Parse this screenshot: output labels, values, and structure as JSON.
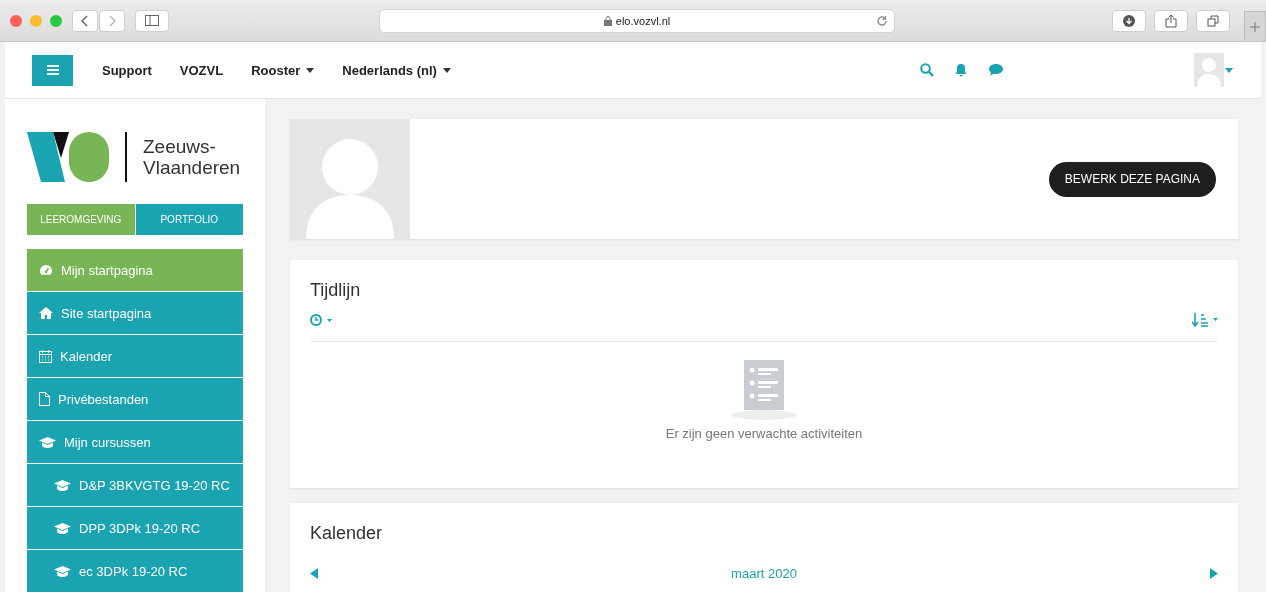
{
  "browser": {
    "url": "elo.vozvl.nl"
  },
  "navbar": {
    "links": [
      {
        "label": "Support",
        "dropdown": false
      },
      {
        "label": "VOZVL",
        "dropdown": false
      },
      {
        "label": "Rooster",
        "dropdown": true
      },
      {
        "label": "Nederlands (nl)",
        "dropdown": true
      }
    ]
  },
  "logo": {
    "lines": [
      "Zeeuws-",
      "Vlaanderen"
    ]
  },
  "tabs": [
    {
      "label": "LEEROMGEVING",
      "selected": true
    },
    {
      "label": "PORTFOLIO",
      "selected": false
    }
  ],
  "sidebar": {
    "items": [
      {
        "label": "Mijn startpagina",
        "kind": "dashboard",
        "selected": true
      },
      {
        "label": "Site startpagina",
        "kind": "home",
        "selected": false
      },
      {
        "label": "Kalender",
        "kind": "calendar",
        "selected": false
      },
      {
        "label": "Privébestanden",
        "kind": "file",
        "selected": false
      },
      {
        "label": "Mijn cursussen",
        "kind": "course",
        "selected": false,
        "children": [
          {
            "label": "D&P 3BKVGTG 19-20 RC",
            "kind": "course",
            "selected": false
          },
          {
            "label": "DPP 3DPk 19-20 RC",
            "kind": "course",
            "selected": false
          },
          {
            "label": "ec 3DPk 19-20 RC",
            "kind": "course",
            "selected": false
          }
        ]
      }
    ]
  },
  "profile": {
    "button": "BEWERK DEZE PAGINA"
  },
  "timeline": {
    "title": "Tijdlijn",
    "empty": "Er zijn geen verwachte activiteiten"
  },
  "calendar": {
    "title": "Kalender",
    "month": "maart 2020"
  }
}
